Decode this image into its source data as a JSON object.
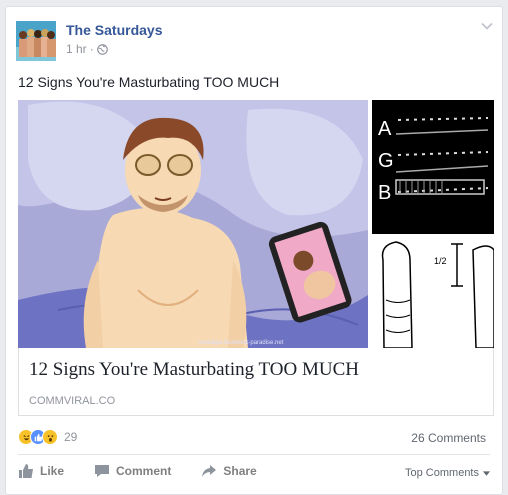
{
  "post": {
    "page_name": "The Saturdays",
    "time": "1 hr",
    "separator": "·",
    "audience_icon": "globe-icon",
    "text": "12 Signs You're Masturbating TOO MUCH"
  },
  "link": {
    "title": "12 Signs You're Masturbating TOO MUCH",
    "domain": "COMMVIRAL.CO",
    "image_watermark": "nostalgia-facebook-paradise.net",
    "panel_letters": [
      "A",
      "G",
      "B"
    ],
    "diagram_label": "1/2"
  },
  "reactions": {
    "icons": [
      "haha-reaction-icon",
      "like-reaction-icon",
      "wow-reaction-icon"
    ],
    "count": "29",
    "comments": "26 Comments"
  },
  "actions": {
    "like": "Like",
    "comment": "Comment",
    "share": "Share",
    "sort": "Top Comments"
  },
  "colors": {
    "link_blue": "#365899",
    "like_blue": "#5890ff",
    "meta_grey": "#90949c"
  }
}
